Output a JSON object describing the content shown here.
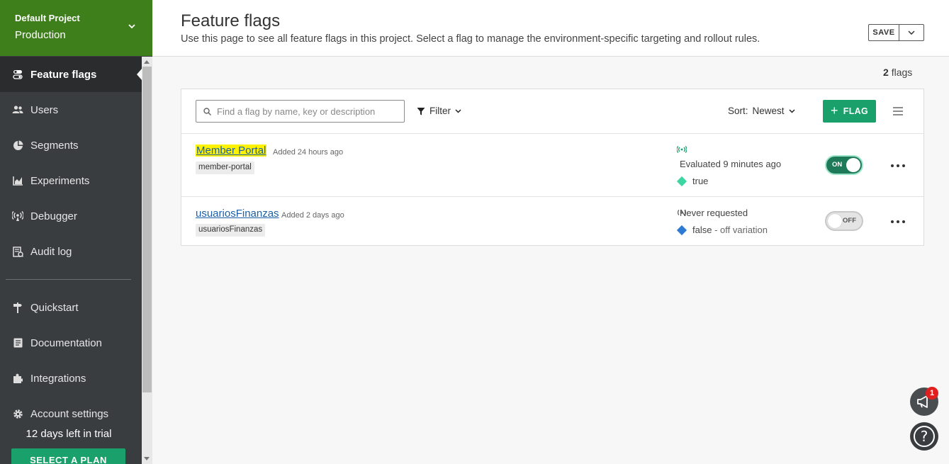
{
  "sidebar": {
    "project_name": "Default Project",
    "environment": "Production",
    "items": [
      {
        "label": "Feature flags",
        "icon": "toggle-icon",
        "active": true
      },
      {
        "label": "Users",
        "icon": "users-icon"
      },
      {
        "label": "Segments",
        "icon": "pie-chart-icon"
      },
      {
        "label": "Experiments",
        "icon": "bar-chart-icon"
      },
      {
        "label": "Debugger",
        "icon": "broadcast-icon"
      },
      {
        "label": "Audit log",
        "icon": "audit-log-icon"
      }
    ],
    "secondary_items": [
      {
        "label": "Quickstart",
        "icon": "signpost-icon"
      },
      {
        "label": "Documentation",
        "icon": "document-icon"
      },
      {
        "label": "Integrations",
        "icon": "puzzle-icon"
      },
      {
        "label": "Account settings",
        "icon": "gear-icon"
      }
    ],
    "trial_text": "12 days left in trial",
    "plan_button": "SELECT A PLAN"
  },
  "header": {
    "title": "Feature flags",
    "description": "Use this page to see all feature flags in this project. Select a flag to manage the environment-specific targeting and rollout rules.",
    "save_label": "SAVE"
  },
  "summary": {
    "count": "2",
    "count_label": "flags"
  },
  "toolbar": {
    "search_placeholder": "Find a flag by name, key or description",
    "filter_label": "Filter",
    "sort_label": "Sort:",
    "sort_value": "Newest",
    "add_flag_label": "FLAG"
  },
  "flags": [
    {
      "name": "Member Portal",
      "added": "Added 24 hours ago",
      "key": "member-portal",
      "evaluation": "Evaluated 9 minutes ago",
      "variation": "true",
      "variation_note": "",
      "variation_color": "#3dd6a0",
      "toggle": "ON"
    },
    {
      "name": "usuariosFinanzas",
      "added": "Added 2 days ago",
      "key": "usuariosFinanzas",
      "evaluation": "Never requested",
      "variation": "false",
      "variation_note": "- off variation",
      "variation_color": "#2e7bd6",
      "toggle": "OFF"
    }
  ],
  "notifications": {
    "badge_count": "1"
  },
  "colors": {
    "brand_green": "#3e7f1c",
    "accent_green": "#19a06b",
    "sidebar_bg": "#3a3d40"
  }
}
